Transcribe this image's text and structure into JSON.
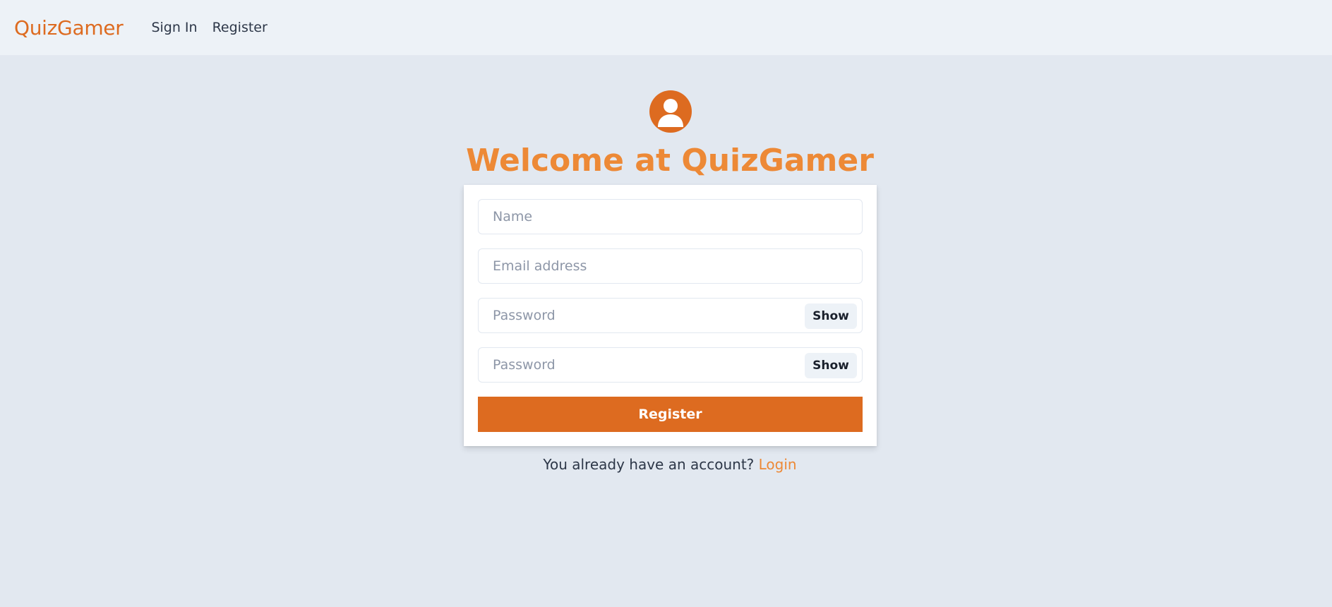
{
  "nav": {
    "brand": "QuizGamer",
    "links": [
      "Sign In",
      "Register"
    ]
  },
  "page": {
    "avatar_icon": "user-circle-icon",
    "heading": "Welcome at QuizGamer"
  },
  "form": {
    "name_placeholder": "Name",
    "email_placeholder": "Email address",
    "password_placeholder": "Password",
    "confirm_placeholder": "Password",
    "show_label": "Show",
    "submit_label": "Register"
  },
  "footer": {
    "prompt": "You already have an account?",
    "link": "Login"
  },
  "colors": {
    "accent": "#dd6b20",
    "heading": "#ed8936",
    "background": "#e2e8f0",
    "nav_background": "#edf2f7"
  }
}
